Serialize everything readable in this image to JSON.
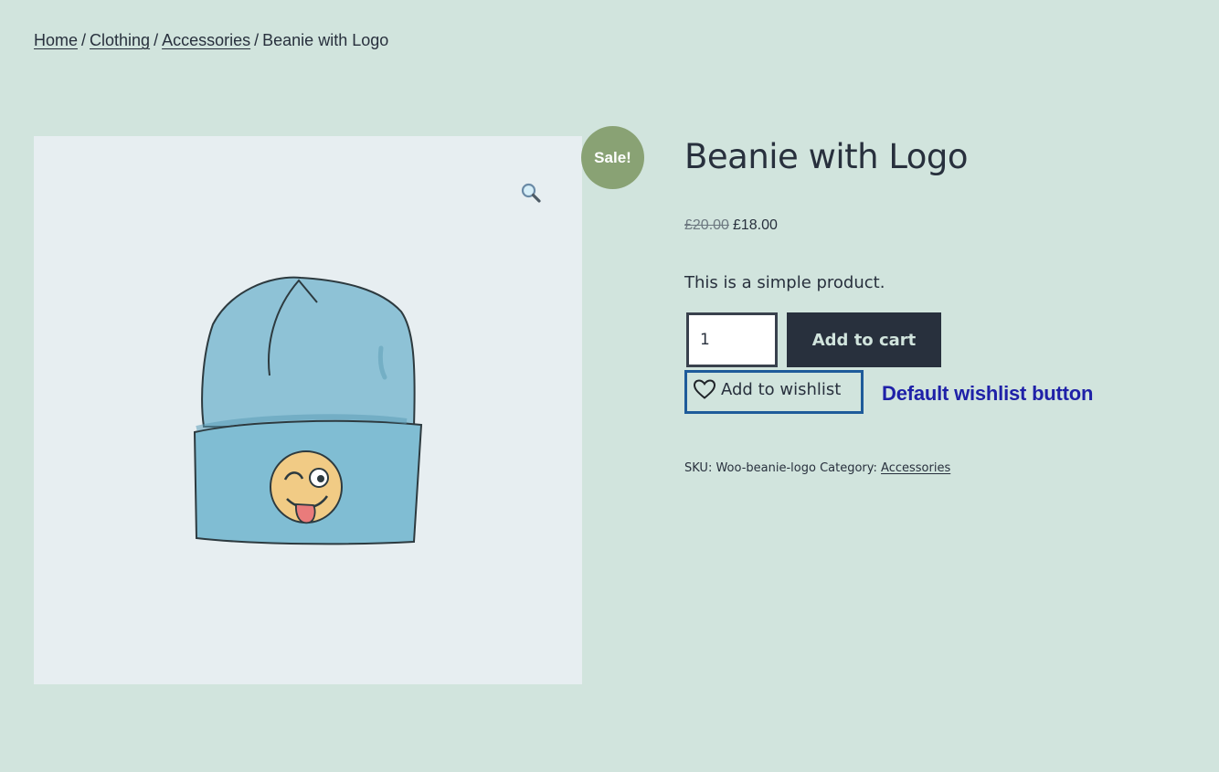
{
  "breadcrumb": {
    "items": [
      "Home",
      "Clothing",
      "Accessories"
    ],
    "separator": "/",
    "current": "Beanie with Logo"
  },
  "gallery": {
    "zoom_icon": "magnifier-icon",
    "sale_badge": "Sale!",
    "image_subject": "beanie-with-winking-face-logo"
  },
  "product": {
    "title": "Beanie with Logo",
    "price_regular": "£20.00",
    "price_sale": "£18.00",
    "description": "This is a simple product.",
    "quantity": "1",
    "add_to_cart_label": "Add to cart",
    "wishlist_label": "Add to wishlist",
    "wishlist_icon": "heart-outline-icon",
    "annotation": "Default wishlist button",
    "sku_label": "SKU:",
    "sku_value": "Woo-beanie-logo",
    "category_label": "Category:",
    "category_value": "Accessories"
  },
  "colors": {
    "background": "#d1e4dd",
    "sale_badge": "#89a274",
    "button_dark": "#28303d",
    "wishlist_border": "#1e5b9a",
    "annotation_text": "#1f21a8"
  }
}
